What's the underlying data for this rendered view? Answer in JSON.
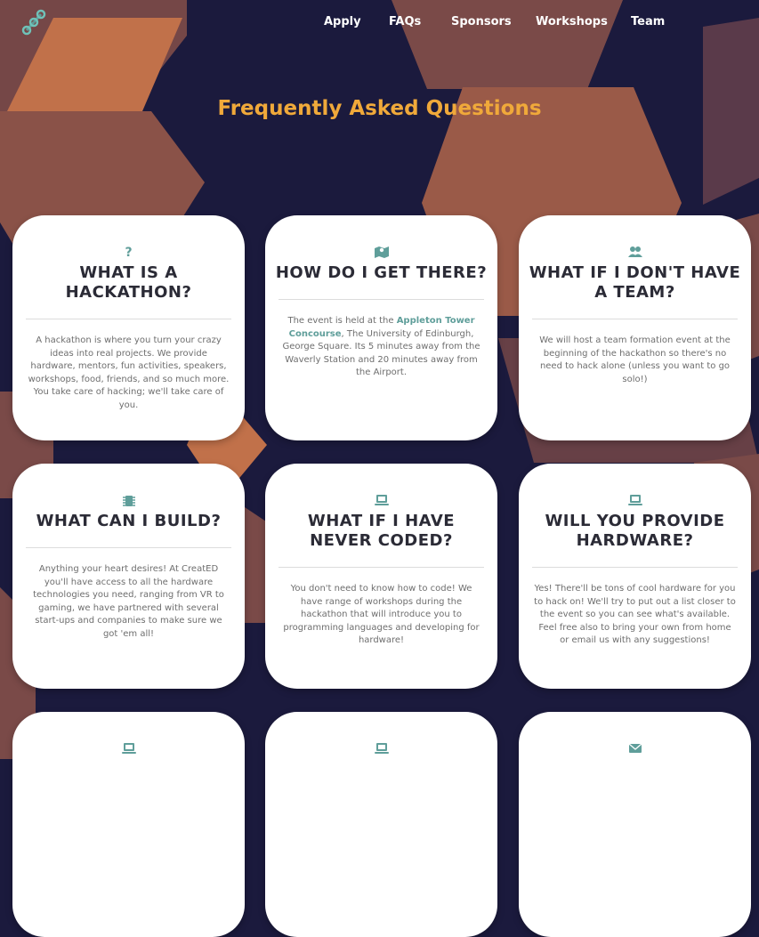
{
  "nav": {
    "items": [
      {
        "label": "Apply"
      },
      {
        "label": "FAQs"
      },
      {
        "label": "Sponsors"
      },
      {
        "label": "Workshops"
      },
      {
        "label": "Team"
      }
    ]
  },
  "page": {
    "title": "Frequently Asked Questions"
  },
  "faqs": [
    {
      "icon": "question-icon",
      "icon_glyph": "?",
      "title": "WHAT IS A HACKATHON?",
      "body": "A hackathon is where you turn your crazy ideas into real projects. We provide hardware, mentors, fun activities, speakers, workshops, food, friends, and so much more. You take care of hacking; we'll take care of you."
    },
    {
      "icon": "map-icon",
      "title": "HOW DO I GET THERE?",
      "body_pre": "The event is held at the ",
      "body_link": "Appleton Tower Concourse",
      "body_post": ", The University of Edinburgh, George Square. Its 5 minutes away from the Waverly Station and 20 minutes away from the Airport."
    },
    {
      "icon": "users-icon",
      "title": "WHAT IF I DON'T HAVE A TEAM?",
      "body": "We will host a team formation event at the beginning of the hackathon so there's no need to hack alone (unless you want to go solo!)"
    },
    {
      "icon": "chip-icon",
      "title": "WHAT CAN I BUILD?",
      "body": "Anything your heart desires! At CreatED you'll have access to all the hardware technologies you need, ranging from VR to gaming, we have partnered with several start-ups and companies to make sure we got 'em all!"
    },
    {
      "icon": "laptop-icon",
      "title": "WHAT IF I HAVE NEVER CODED?",
      "body": "You don't need to know how to code! We have range of workshops during the hackathon that will introduce you to programming languages and developing for hardware!"
    },
    {
      "icon": "laptop-icon",
      "title": "WILL YOU PROVIDE HARDWARE?",
      "body": "Yes! There'll be tons of cool hardware for you to hack on! We'll try to put out a list closer to the event so you can see what's available. Feel free also to bring your own from home or email us with any suggestions!"
    },
    {
      "icon": "laptop-icon"
    },
    {
      "icon": "laptop-icon"
    },
    {
      "icon": "envelope-icon"
    }
  ],
  "colors": {
    "background": "#1b1a3d",
    "hexagon_light": "#c1714a",
    "hexagon_dark": "#7a4a48",
    "title_accent": "#f0a93a",
    "icon_teal": "#5f9e9a",
    "card": "#ffffff"
  }
}
